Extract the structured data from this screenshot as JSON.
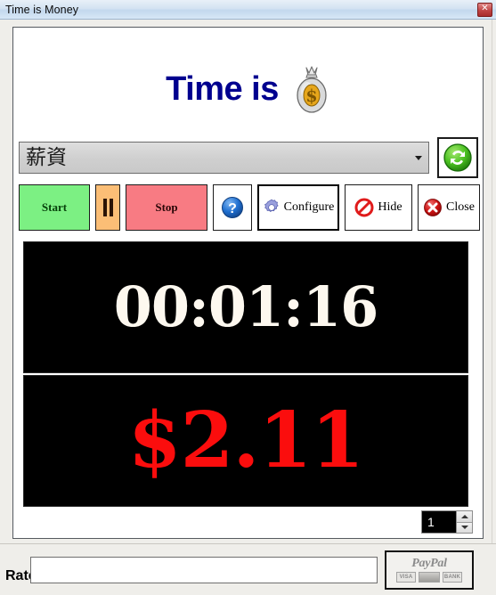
{
  "window": {
    "title": "Time is Money",
    "close_button_icon": "close-icon",
    "close_glyph": "✕"
  },
  "header": {
    "title": "Time is",
    "icon": "money-bag-icon"
  },
  "selector": {
    "value": "薪資",
    "arrow_icon": "chevron-down-icon",
    "refresh_icon": "refresh-icon"
  },
  "toolbar": {
    "start_label": "Start",
    "pause_label": "",
    "pause_icon": "pause-icon",
    "stop_label": "Stop",
    "help_label": "",
    "help_icon": "help-question-icon",
    "configure_label": "Configure",
    "configure_icon": "gear-icon",
    "hide_label": "Hide",
    "hide_icon": "no-entry-icon",
    "close_label": "Close",
    "close_icon": "red-x-icon"
  },
  "displays": {
    "time_value": "00:01:16",
    "money_value": "$2.11",
    "time_color": "#fdf8ef",
    "money_color": "#fb0d0d",
    "background_color": "#000000"
  },
  "spinner": {
    "value": "1",
    "up_icon": "caret-up-icon",
    "down_icon": "caret-down-icon"
  },
  "footer": {
    "rate_label": "Rate",
    "rate_value": "",
    "rate_placeholder": "",
    "paypal_label": "PayPal",
    "card_visa": "VISA",
    "card_mastercard": "",
    "card_bank": "BANK"
  },
  "colors": {
    "title_text": "#00008f",
    "start_button": "#7cf083",
    "pause_button": "#fbbe76",
    "stop_button": "#f87b83",
    "refresh_green": "#3fbb1f",
    "accent_red": "#c42020"
  }
}
